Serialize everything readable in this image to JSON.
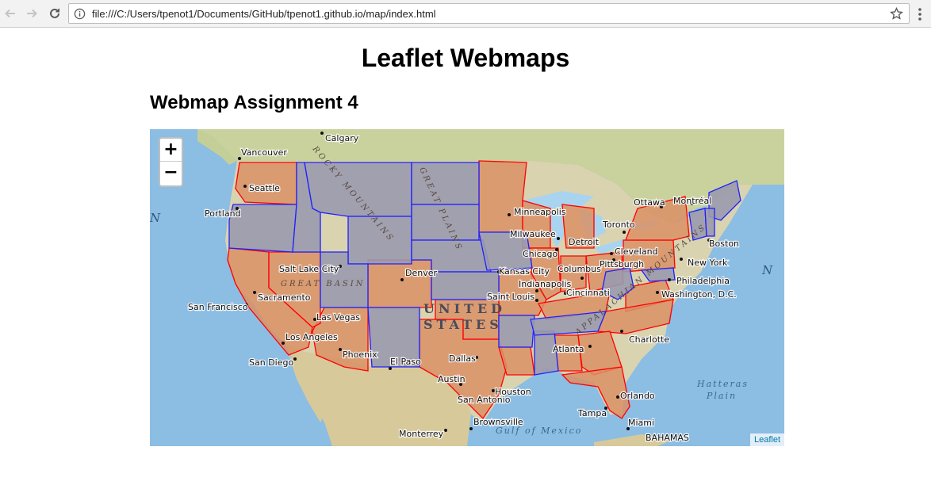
{
  "browser": {
    "url": "file:///C:/Users/tpenot1/Documents/GitHub/tpenot1.github.io/map/index.html"
  },
  "page": {
    "title": "Leaflet Webmaps",
    "subtitle": "Webmap Assignment 4"
  },
  "map": {
    "zoom_in_label": "+",
    "zoom_out_label": "−",
    "attribution": "Leaflet",
    "colors": {
      "ocean": "#8cbde3",
      "land": "#d9d3b0",
      "canada": "#c9d29d",
      "mexico": "#d8c99a",
      "red_state_fill": "#d99166",
      "red_state_stroke": "#ff0000",
      "blue_state_fill": "#9a9aae",
      "blue_state_stroke": "#2020ff",
      "lake": "#a9d4ef"
    },
    "water_labels": [
      "N",
      "N"
    ],
    "country_label_1": "UNITED",
    "country_label_2": "STATES",
    "terrain_labels": [
      "GREAT PLAINS",
      "GREAT BASIN",
      "ROCKY MOUNTAINS",
      "APPALACHIAN MOUNTAINS"
    ],
    "gulf_label": "Gulf of Mexico",
    "hatteras_1": "Hatteras",
    "hatteras_2": "Plain",
    "bahamas": "BAHAMAS",
    "cities": [
      "Calgary",
      "Vancouver",
      "Seattle",
      "Portland",
      "Salt Lake City",
      "Denver",
      "Sacramento",
      "San Francisco",
      "Las Vegas",
      "Los Angeles",
      "Phoenix",
      "San Diego",
      "El Paso",
      "Minneapolis",
      "Milwaukee",
      "Chicago",
      "Detroit",
      "Toronto",
      "Ottawa",
      "Montréal",
      "Boston",
      "Cleveland",
      "Pittsburgh",
      "New York",
      "Philadelphia",
      "Washington, D.C.",
      "Columbus",
      "Indianapolis",
      "Kansas City",
      "Saint Louis",
      "Cincinnati",
      "Charlotte",
      "Atlanta",
      "Dallas",
      "Austin",
      "Houston",
      "San Antonio",
      "Orlando",
      "Tampa",
      "Miami",
      "Brownsville",
      "Monterrey"
    ]
  }
}
